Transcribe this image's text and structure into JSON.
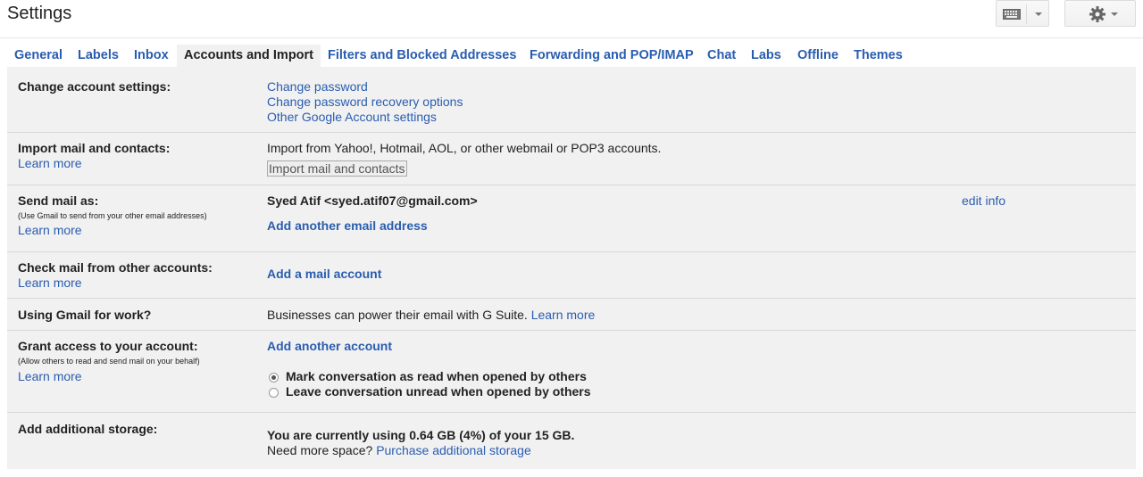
{
  "header": {
    "title": "Settings",
    "keyboard_icon": "keyboard-icon",
    "gear_icon": "gear-icon"
  },
  "tabs": [
    {
      "label": "General"
    },
    {
      "label": "Labels"
    },
    {
      "label": "Inbox"
    },
    {
      "label": "Accounts and Import",
      "active": true
    },
    {
      "label": "Filters and Blocked Addresses"
    },
    {
      "label": "Forwarding and POP/IMAP"
    },
    {
      "label": "Chat"
    },
    {
      "label": "Labs"
    },
    {
      "label": "Offline"
    },
    {
      "label": "Themes"
    }
  ],
  "rows": {
    "change_account": {
      "label": "Change account settings:",
      "links": [
        "Change password",
        "Change password recovery options",
        "Other Google Account settings"
      ]
    },
    "import": {
      "label": "Import mail and contacts:",
      "learn_more": "Learn more",
      "text": "Import from Yahoo!, Hotmail, AOL, or other webmail or POP3 accounts.",
      "button": "Import mail and contacts"
    },
    "send_as": {
      "label": "Send mail as:",
      "sub": "(Use Gmail to send from your other email addresses)",
      "learn_more": "Learn more",
      "address": "Syed Atif <syed.atif07@gmail.com>",
      "edit": "edit info",
      "add": "Add another email address"
    },
    "check_mail": {
      "label": "Check mail from other accounts:",
      "learn_more": "Learn more",
      "add": "Add a mail account"
    },
    "work": {
      "label": "Using Gmail for work?",
      "text": "Businesses can power their email with G Suite.",
      "link": "Learn more"
    },
    "grant": {
      "label": "Grant access to your account:",
      "sub": "(Allow others to read and send mail on your behalf)",
      "learn_more": "Learn more",
      "add": "Add another account",
      "options": [
        {
          "label": "Mark conversation as read when opened by others",
          "selected": true
        },
        {
          "label": "Leave conversation unread when opened by others",
          "selected": false
        }
      ]
    },
    "storage": {
      "label": "Add additional storage:",
      "usage": "You are currently using 0.64 GB (4%) of your 15 GB.",
      "need": "Need more space?",
      "link": "Purchase additional storage"
    }
  }
}
